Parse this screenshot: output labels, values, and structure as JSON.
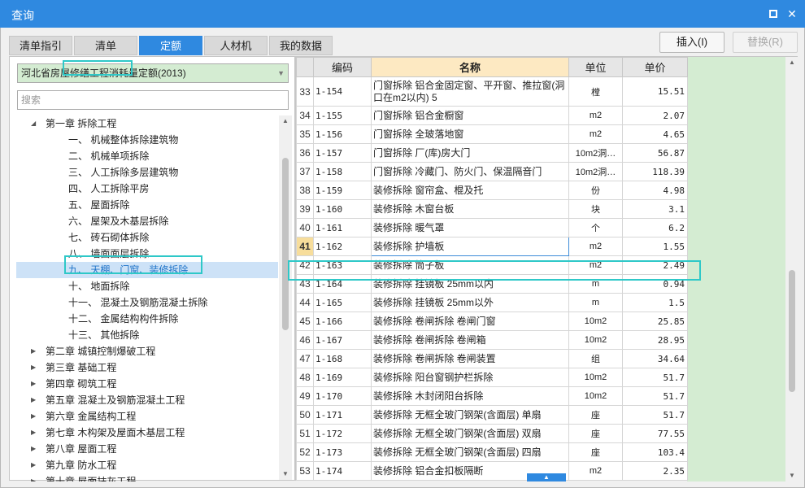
{
  "window": {
    "title": "查询",
    "maximize_label": "□",
    "close_label": "✕"
  },
  "tabs": [
    {
      "label": "清单指引",
      "active": false
    },
    {
      "label": "清单",
      "active": false
    },
    {
      "label": "定额",
      "active": true
    },
    {
      "label": "人材机",
      "active": false
    },
    {
      "label": "我的数据",
      "active": false
    }
  ],
  "actions": {
    "insert_label": "插入(I)",
    "replace_label": "替换(R)"
  },
  "left": {
    "quota_select": "河北省房屋修缮工程消耗量定额(2013)",
    "search_placeholder": "搜索",
    "tree": [
      {
        "label": "第一章 拆除工程",
        "level": 0,
        "expanded": true
      },
      {
        "label": "一、 机械整体拆除建筑物",
        "level": 1
      },
      {
        "label": "二、 机械单项拆除",
        "level": 1
      },
      {
        "label": "三、 人工拆除多层建筑物",
        "level": 1
      },
      {
        "label": "四、 人工拆除平房",
        "level": 1
      },
      {
        "label": "五、 屋面拆除",
        "level": 1
      },
      {
        "label": "六、 屋架及木基层拆除",
        "level": 1
      },
      {
        "label": "七、 砖石砌体拆除",
        "level": 1
      },
      {
        "label": "八、 墙面面层拆除",
        "level": 1
      },
      {
        "label": "九、 天棚、门窗、装修拆除",
        "level": 1,
        "selected": true
      },
      {
        "label": "十、 地面拆除",
        "level": 1
      },
      {
        "label": "十一、 混凝土及钢筋混凝土拆除",
        "level": 1
      },
      {
        "label": "十二、 金属结构构件拆除",
        "level": 1
      },
      {
        "label": "十三、 其他拆除",
        "level": 1
      },
      {
        "label": "第二章 城镇控制爆破工程",
        "level": 0,
        "expanded": false
      },
      {
        "label": "第三章 基础工程",
        "level": 0,
        "expanded": false
      },
      {
        "label": "第四章 砌筑工程",
        "level": 0,
        "expanded": false
      },
      {
        "label": "第五章 混凝土及钢筋混凝土工程",
        "level": 0,
        "expanded": false
      },
      {
        "label": "第六章 金属结构工程",
        "level": 0,
        "expanded": false
      },
      {
        "label": "第七章 木构架及屋面木基层工程",
        "level": 0,
        "expanded": false
      },
      {
        "label": "第八章 屋面工程",
        "level": 0,
        "expanded": false
      },
      {
        "label": "第九章 防水工程",
        "level": 0,
        "expanded": false
      },
      {
        "label": "第十章 屋面抹灰工程",
        "level": 0,
        "expanded": false
      }
    ]
  },
  "grid": {
    "headers": {
      "code": "编码",
      "name": "名称",
      "unit": "单位",
      "price": "单价"
    },
    "current_row": "41",
    "rows": [
      {
        "idx": "33",
        "code": "1-154",
        "name": "门窗拆除 铝合金固定窗、平开窗、推拉窗(洞口在m2以内) 5",
        "unit": "樘",
        "price": "15.51"
      },
      {
        "idx": "34",
        "code": "1-155",
        "name": "门窗拆除 铝合金橱窗",
        "unit": "m2",
        "price": "2.07"
      },
      {
        "idx": "35",
        "code": "1-156",
        "name": "门窗拆除 全玻落地窗",
        "unit": "m2",
        "price": "4.65"
      },
      {
        "idx": "36",
        "code": "1-157",
        "name": "门窗拆除 厂(库)房大门",
        "unit": "10m2洞…",
        "price": "56.87"
      },
      {
        "idx": "37",
        "code": "1-158",
        "name": "门窗拆除 冷藏门、防火门、保温隔音门",
        "unit": "10m2洞…",
        "price": "118.39"
      },
      {
        "idx": "38",
        "code": "1-159",
        "name": "装修拆除 窗帘盒、棍及托",
        "unit": "份",
        "price": "4.98"
      },
      {
        "idx": "39",
        "code": "1-160",
        "name": "装修拆除 木窗台板",
        "unit": "块",
        "price": "3.1"
      },
      {
        "idx": "40",
        "code": "1-161",
        "name": "装修拆除 暖气罩",
        "unit": "个",
        "price": "6.2"
      },
      {
        "idx": "41",
        "code": "1-162",
        "name": "装修拆除 护墙板",
        "unit": "m2",
        "price": "1.55"
      },
      {
        "idx": "42",
        "code": "1-163",
        "name": "装修拆除 筒子板",
        "unit": "m2",
        "price": "2.49"
      },
      {
        "idx": "43",
        "code": "1-164",
        "name": "装修拆除 挂镜板 25mm以内",
        "unit": "m",
        "price": "0.94"
      },
      {
        "idx": "44",
        "code": "1-165",
        "name": "装修拆除 挂镜板 25mm以外",
        "unit": "m",
        "price": "1.5"
      },
      {
        "idx": "45",
        "code": "1-166",
        "name": "装修拆除 卷闸拆除 卷闸门窗",
        "unit": "10m2",
        "price": "25.85"
      },
      {
        "idx": "46",
        "code": "1-167",
        "name": "装修拆除 卷闸拆除 卷闸箱",
        "unit": "10m2",
        "price": "28.95"
      },
      {
        "idx": "47",
        "code": "1-168",
        "name": "装修拆除 卷闸拆除 卷闸装置",
        "unit": "组",
        "price": "34.64"
      },
      {
        "idx": "48",
        "code": "1-169",
        "name": "装修拆除 阳台窗钢护栏拆除",
        "unit": "10m2",
        "price": "51.7"
      },
      {
        "idx": "49",
        "code": "1-170",
        "name": "装修拆除 木封闭阳台拆除",
        "unit": "10m2",
        "price": "51.7"
      },
      {
        "idx": "50",
        "code": "1-171",
        "name": "装修拆除 无框全玻门钢架(含面层) 单扇",
        "unit": "座",
        "price": "51.7"
      },
      {
        "idx": "51",
        "code": "1-172",
        "name": "装修拆除 无框全玻门钢架(含面层) 双扇",
        "unit": "座",
        "price": "77.55"
      },
      {
        "idx": "52",
        "code": "1-173",
        "name": "装修拆除 无框全玻门钢架(含面层) 四扇",
        "unit": "座",
        "price": "103.4"
      },
      {
        "idx": "53",
        "code": "1-174",
        "name": "装修拆除 铝合金扣板隔断",
        "unit": "m2",
        "price": "2.35"
      }
    ]
  },
  "colors": {
    "accent": "#2f89e0",
    "highlight_box": "#2ec8c8",
    "green_fill": "#d4ecd2",
    "name_header": "#fde9c2",
    "current_row_index": "#f7dd9b"
  }
}
